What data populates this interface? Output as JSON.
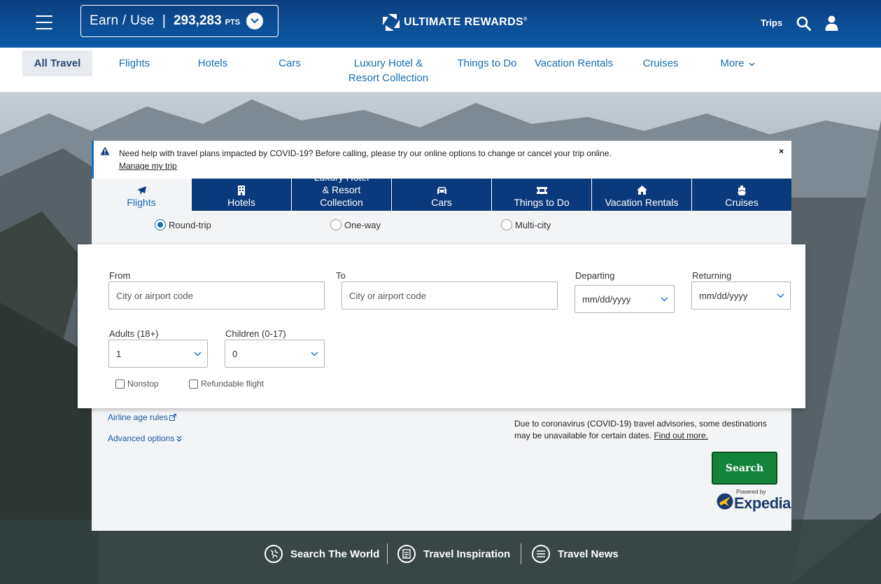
{
  "header": {
    "earn_label": "Earn / Use",
    "separator": "|",
    "points": "293,283",
    "points_unit": "PTS",
    "brand": "ULTIMATE REWARDS",
    "brand_reg": "®",
    "trips": "Trips"
  },
  "subnav": {
    "items": [
      {
        "label": "All Travel"
      },
      {
        "label": "Flights"
      },
      {
        "label": "Hotels"
      },
      {
        "label": "Cars"
      },
      {
        "label": "Luxury Hotel & Resort Collection"
      },
      {
        "label": "Things to Do"
      },
      {
        "label": "Vacation Rentals"
      },
      {
        "label": "Cruises"
      },
      {
        "label": "More"
      }
    ]
  },
  "alert": {
    "text": "Need help with travel plans impacted by COVID-19? Before calling, please try our online options to change or cancel your trip online.",
    "link": "Manage my trip",
    "close": "×"
  },
  "tabs": [
    {
      "label": "Flights",
      "icon": "airplane-icon"
    },
    {
      "label": "Hotels",
      "icon": "building-icon"
    },
    {
      "label": "Luxury Hotel & Resort Collection",
      "icon": ""
    },
    {
      "label": "Cars",
      "icon": "car-icon"
    },
    {
      "label": "Things to Do",
      "icon": "ticket-icon"
    },
    {
      "label": "Vacation Rentals",
      "icon": "house-icon"
    },
    {
      "label": "Cruises",
      "icon": "ship-icon"
    }
  ],
  "trip_type": {
    "round_trip": "Round-trip",
    "one_way": "One-way",
    "multi_city": "Multi-city"
  },
  "form": {
    "from_label": "From",
    "from_placeholder": "City or airport code",
    "to_label": "To",
    "to_placeholder": "City or airport code",
    "departing_label": "Departing",
    "departing_value": "mm/dd/yyyy",
    "returning_label": "Returning",
    "returning_value": "mm/dd/yyyy",
    "adults_label": "Adults (18+)",
    "adults_value": "1",
    "children_label": "Children (0-17)",
    "children_value": "0",
    "nonstop": "Nonstop",
    "refundable": "Refundable flight"
  },
  "panel": {
    "airline_age_rules": "Airline age rules",
    "advanced_options": "Advanced options",
    "covid_note": "Due to coronavirus (COVID-19) travel advisories, some destinations may be unavailable for certain dates.",
    "find_out_more": "Find out more.",
    "search_button": "Search",
    "powered_by": "Powered by",
    "expedia": "Expedia"
  },
  "footer": {
    "search_world": "Search The World",
    "travel_inspiration": "Travel Inspiration",
    "travel_news": "Travel News"
  },
  "colors": {
    "header_blue": "#0d5aa7",
    "tab_navy": "#0b3a7c",
    "link_blue": "#1a6cb5",
    "search_green": "#14833b"
  }
}
